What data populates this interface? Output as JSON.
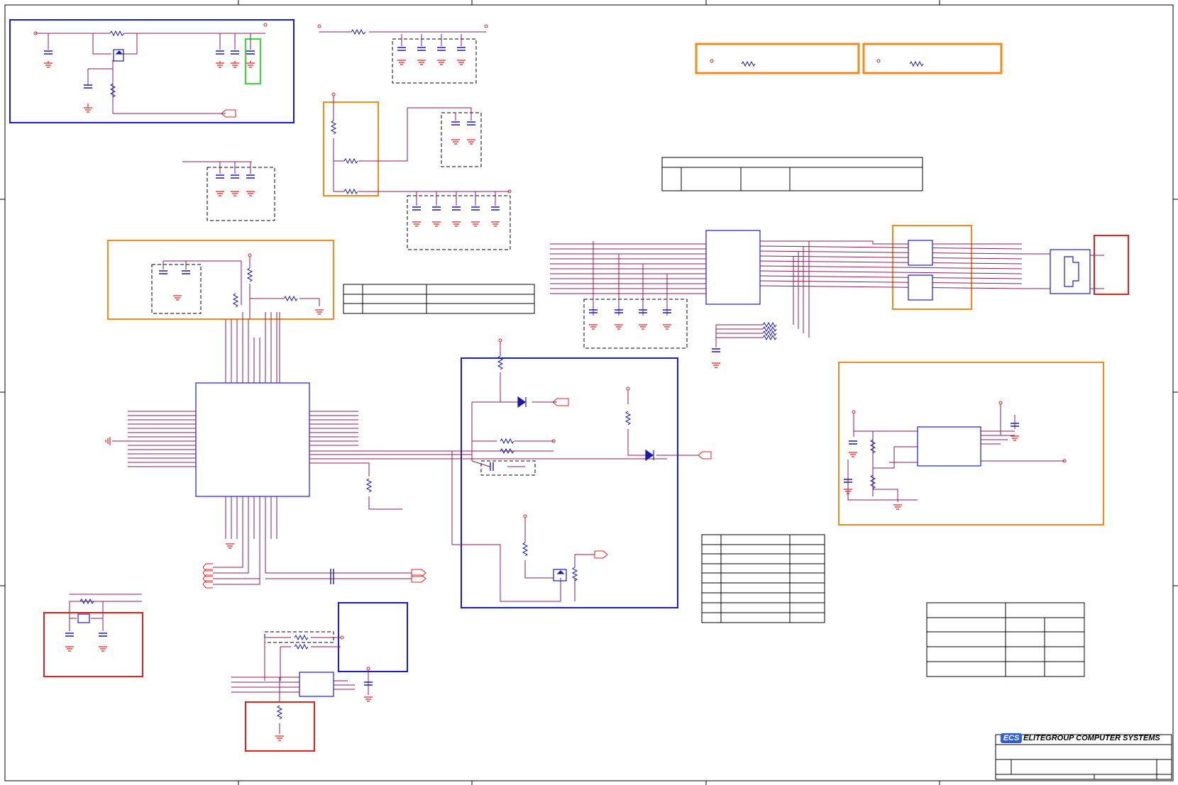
{
  "title_block": {
    "logo_text": "ECS",
    "company_name": "ELITEGROUP COMPUTER SYSTEMS"
  },
  "colors": {
    "wire": "#8b1a5c",
    "ground": "#e02020",
    "component": "#1a1aaa",
    "box_blue": "#1a1add",
    "box_orange": "#f28a1c",
    "box_red": "#e02020",
    "box_green": "#33dd33",
    "border": "#000000"
  }
}
